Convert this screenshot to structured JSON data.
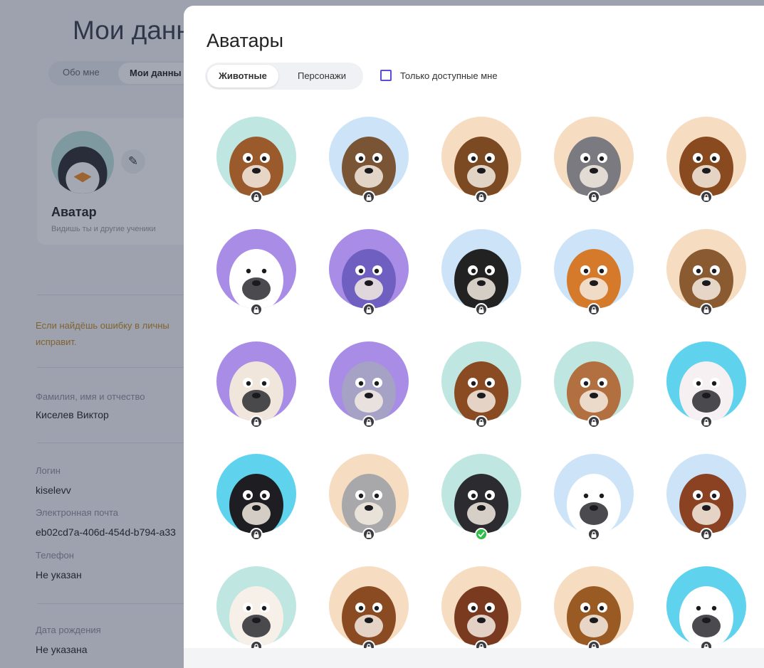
{
  "background": {
    "page_title": "Мои данн",
    "tabs": [
      "Обо мне",
      "Мои данны"
    ],
    "avatar_card": {
      "title": "Аватар",
      "subtitle": "Видишь ты и другие ученики"
    },
    "notice_line1": "Если найдёшь ошибку в личны",
    "notice_line2": "исправит.",
    "fields": [
      {
        "label": "Фамилия, имя и отчество",
        "value": "Киселев Виктор"
      },
      {
        "label": "Логин",
        "value": "kiselevv"
      },
      {
        "label": "Электронная почта",
        "value": "eb02cd7a-406d-454d-b794-a33"
      },
      {
        "label": "Телефон",
        "value": "Не указан"
      },
      {
        "label": "Дата рождения",
        "value": "Не указана"
      }
    ]
  },
  "modal": {
    "title": "Аватары",
    "tabs": {
      "animals": "Животные",
      "characters": "Персонажи"
    },
    "filter_label": "Только доступные мне",
    "avatars": [
      {
        "name": "basset-hound",
        "bg": "#bfe6e0",
        "fur": "#9a5a2c",
        "state": "locked"
      },
      {
        "name": "boar",
        "bg": "#cde4f8",
        "fur": "#7a5535",
        "state": "locked"
      },
      {
        "name": "bear",
        "bg": "#f6dcc0",
        "fur": "#7b4a22",
        "state": "locked"
      },
      {
        "name": "raccoon",
        "bg": "#f6dcc0",
        "fur": "#7a7a80",
        "state": "locked"
      },
      {
        "name": "beaver",
        "bg": "#f6dcc0",
        "fur": "#8a4a20",
        "state": "locked"
      },
      {
        "name": "zebra",
        "bg": "#a88ce6",
        "fur": "#ffffff",
        "state": "locked"
      },
      {
        "name": "ostrich",
        "bg": "#a88ce6",
        "fur": "#6f5fc0",
        "state": "locked"
      },
      {
        "name": "skunk",
        "bg": "#cde4f8",
        "fur": "#222222",
        "state": "locked"
      },
      {
        "name": "lion-cub",
        "bg": "#cde4f8",
        "fur": "#d57a2a",
        "state": "locked"
      },
      {
        "name": "moose",
        "bg": "#f6dcc0",
        "fur": "#8a5a30",
        "state": "locked"
      },
      {
        "name": "fennec",
        "bg": "#a88ce6",
        "fur": "#f1e6dc",
        "state": "locked"
      },
      {
        "name": "elephant",
        "bg": "#a88ce6",
        "fur": "#a5a2c6",
        "state": "locked"
      },
      {
        "name": "beagle",
        "bg": "#bfe6e0",
        "fur": "#8a4a22",
        "state": "locked"
      },
      {
        "name": "terrier",
        "bg": "#bfe6e0",
        "fur": "#b27040",
        "state": "locked"
      },
      {
        "name": "white-kitten",
        "bg": "#5fd2ee",
        "fur": "#f6f0f2",
        "state": "locked"
      },
      {
        "name": "black-cat",
        "bg": "#5fd2ee",
        "fur": "#1e1e22",
        "state": "locked"
      },
      {
        "name": "koala",
        "bg": "#f6dcc0",
        "fur": "#a8a8aa",
        "state": "locked"
      },
      {
        "name": "penguin",
        "bg": "#bfe6e0",
        "fur": "#2b2b30",
        "state": "selected"
      },
      {
        "name": "polar-bear",
        "bg": "#cde4f8",
        "fur": "#ffffff",
        "state": "locked"
      },
      {
        "name": "walrus",
        "bg": "#cde4f8",
        "fur": "#8a4222",
        "state": "locked"
      },
      {
        "name": "arctic-fox",
        "bg": "#bfe6e0",
        "fur": "#f6f0e8",
        "state": "locked"
      },
      {
        "name": "kangaroo",
        "bg": "#f6dcc0",
        "fur": "#8a4a22",
        "state": "locked"
      },
      {
        "name": "platypus",
        "bg": "#f6dcc0",
        "fur": "#7a3a20",
        "state": "locked"
      },
      {
        "name": "kiwi",
        "bg": "#f6dcc0",
        "fur": "#9a5a24",
        "state": "locked"
      },
      {
        "name": "pirate-cat",
        "bg": "#5fd2ee",
        "fur": "#ffffff",
        "state": "locked"
      }
    ]
  }
}
